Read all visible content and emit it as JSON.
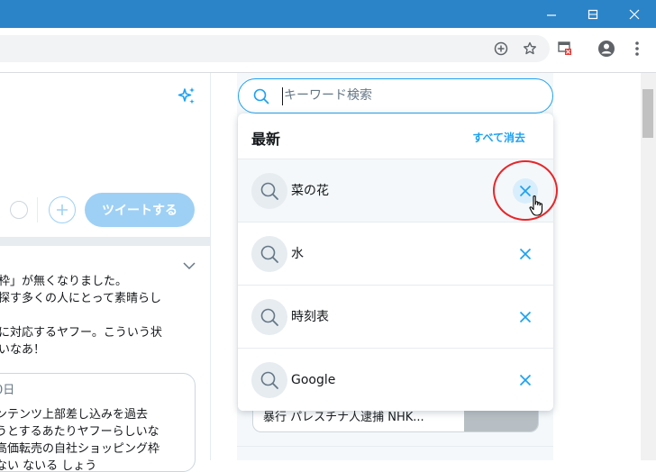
{
  "window": {
    "minimize_icon": "minimize-icon",
    "maximize_icon": "maximize-icon",
    "close_icon": "close-icon",
    "titlebar_color": "#2b84c8"
  },
  "toolbar": {
    "icons": [
      "add-circle-icon",
      "star-icon",
      "extension-icon",
      "account-icon",
      "more-vert-icon"
    ]
  },
  "left": {
    "tweet_button": "ツイートする",
    "tweet_lines": [
      "枠」が無くなりました。",
      "探す多くの人にとって素晴らし",
      "",
      "に対応するヤフー。こういう状",
      "いなあ！"
    ],
    "quote_lines": [
      "0日",
      "ンテンツ上部差し込みを過去",
      "うとするあたりヤフーらしいな",
      "高価転売の自社ショッピング枠",
      "ない ないる しょう"
    ]
  },
  "search": {
    "placeholder": "キーワード検索"
  },
  "recent": {
    "title": "最新",
    "clear_all": "すべて消去",
    "items": [
      {
        "label": "菜の花"
      },
      {
        "label": "水"
      },
      {
        "label": "時刻表"
      },
      {
        "label": "Google"
      }
    ]
  },
  "peek": {
    "text": "暴行 パレスチナ人逮捕 NHK..."
  },
  "colors": {
    "accent": "#1da1f2",
    "annotation_ring": "#e8262a"
  }
}
